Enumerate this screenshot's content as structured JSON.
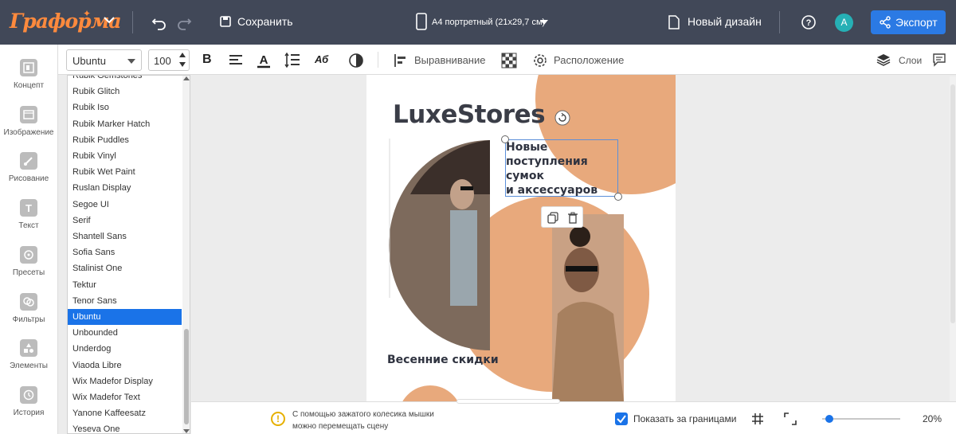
{
  "topbar": {
    "logo": "Граформа",
    "save_label": "Сохранить",
    "format_label": "А4 портретный (21х29,7 см)",
    "new_design_label": "Новый дизайн",
    "avatar_initial": "A",
    "export_label": "Экспорт"
  },
  "toolbar": {
    "font_value": "Ubuntu",
    "size_value": "100",
    "bold_label": "B",
    "ab_label": "Аб",
    "align_label": "Выравнивание",
    "layout_label": "Расположение",
    "layers_label": "Слои"
  },
  "sidebar": {
    "items": [
      {
        "label": "Концепт",
        "icon": "concept-icon"
      },
      {
        "label": "Изображение",
        "icon": "image-icon"
      },
      {
        "label": "Рисование",
        "icon": "brush-icon"
      },
      {
        "label": "Текст",
        "icon": "text-icon"
      },
      {
        "label": "Пресеты",
        "icon": "presets-icon"
      },
      {
        "label": "Фильтры",
        "icon": "filters-icon"
      },
      {
        "label": "Элементы",
        "icon": "elements-icon"
      },
      {
        "label": "История",
        "icon": "history-icon"
      }
    ]
  },
  "font_list": {
    "items": [
      "Rubik Gemstones",
      "Rubik Glitch",
      "Rubik Iso",
      "Rubik Marker Hatch",
      "Rubik Puddles",
      "Rubik Vinyl",
      "Rubik Wet Paint",
      "Ruslan Display",
      "Segoe UI",
      "Serif",
      "Shantell Sans",
      "Sofia Sans",
      "Stalinist One",
      "Tektur",
      "Tenor Sans",
      "Ubuntu",
      "Unbounded",
      "Underdog",
      "Viaoda Libre",
      "Wix Madefor Display",
      "Wix Madefor Text",
      "Yanone Kaffeesatz",
      "Yeseva One"
    ],
    "selected": "Ubuntu"
  },
  "design": {
    "brand": "LuxeStores",
    "headline_lines": [
      "Новые",
      "поступления",
      "сумок",
      "и аксессуаров"
    ],
    "sale_text": "Весенние скидки",
    "accent_color": "#e8a97c"
  },
  "bottombar": {
    "hint_line1": "С помощью зажатого колесика мышки",
    "hint_line2": "можно перемещать сцену",
    "show_outside_label": "Показать за границами",
    "zoom_value": "20%",
    "zoom_level": 0.2
  }
}
